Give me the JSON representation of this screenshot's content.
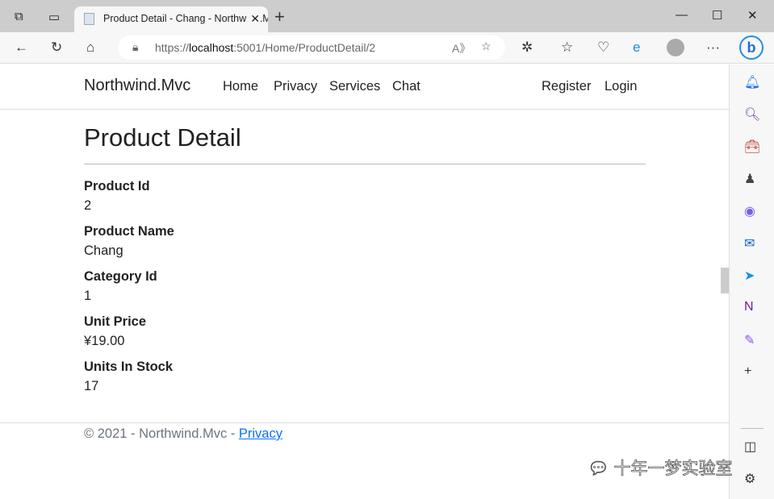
{
  "browser": {
    "tab_title": "Product Detail - Chang - Northwind.Mvc",
    "url_prefix": "https://",
    "url_host": "localhost",
    "url_rest": ":5001/Home/ProductDetail/2"
  },
  "nav": {
    "brand": "Northwind.Mvc",
    "links": [
      "Home",
      "Privacy",
      "Services",
      "Chat"
    ],
    "register": "Register",
    "login": "Login"
  },
  "main": {
    "title": "Product Detail",
    "fields": [
      {
        "label": "Product Id",
        "value": "2"
      },
      {
        "label": "Product Name",
        "value": "Chang"
      },
      {
        "label": "Category Id",
        "value": "1"
      },
      {
        "label": "Unit Price",
        "value": "¥19.00"
      },
      {
        "label": "Units In Stock",
        "value": "17"
      }
    ]
  },
  "footer": {
    "text": "© 2021 - Northwind.Mvc - ",
    "link": "Privacy"
  },
  "watermark": "十年一梦实验室"
}
